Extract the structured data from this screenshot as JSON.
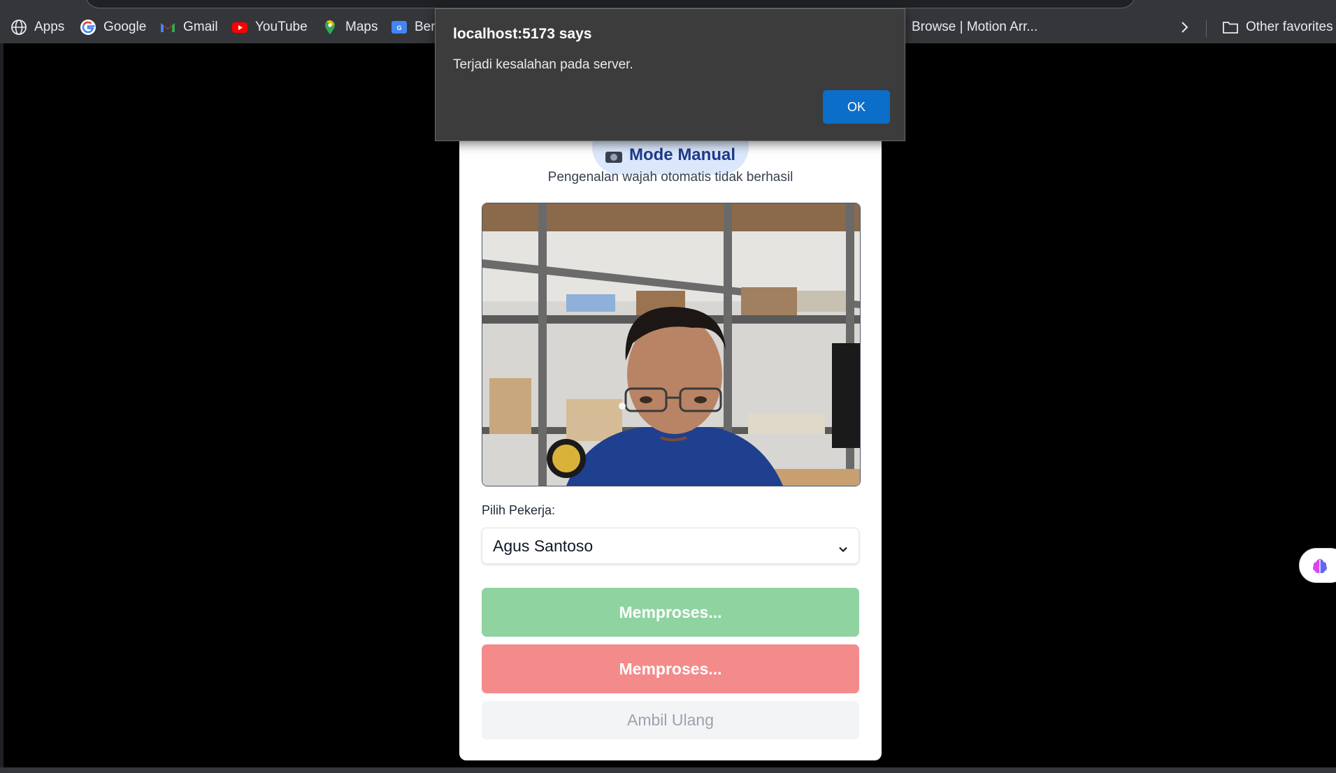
{
  "bookmarks": {
    "items": [
      {
        "label": "Apps",
        "icon": "globe-icon"
      },
      {
        "label": "Google",
        "icon": "google-icon"
      },
      {
        "label": "Gmail",
        "icon": "gmail-icon"
      },
      {
        "label": "YouTube",
        "icon": "youtube-icon"
      },
      {
        "label": "Maps",
        "icon": "maps-icon"
      },
      {
        "label": "Beri",
        "icon": "news-icon"
      },
      {
        "label": "Browse | Motion Arr...",
        "icon": "motion-array-icon"
      }
    ],
    "overflow_icon": "chevron-right-icon",
    "other_favorites": {
      "label": "Other favorites",
      "icon": "folder-icon"
    }
  },
  "dialog": {
    "title": "localhost:5173 says",
    "message": "Terjadi kesalahan pada server.",
    "ok_label": "OK"
  },
  "card": {
    "mode_label": "Mode Manual",
    "mode_icon": "camera-icon",
    "hint": "Pengenalan wajah otomatis tidak berhasil",
    "worker_label": "Pilih Pekerja:",
    "worker_selected": "Agus Santoso",
    "approve_label": "Memproses...",
    "reject_label": "Memproses...",
    "retake_label": "Ambil Ulang"
  },
  "colors": {
    "approve": "#8fd3a1",
    "reject": "#f48b8b",
    "ok_button": "#0b6ec9",
    "mode_pill": "#dbe7fb"
  },
  "side_extension": {
    "icon": "brain-icon"
  }
}
